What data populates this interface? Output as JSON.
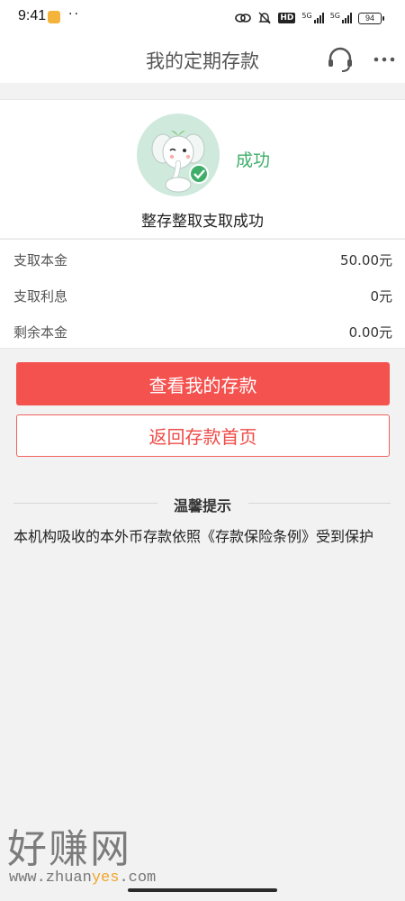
{
  "status_bar": {
    "time": "9:41",
    "hd": "HD",
    "signal1": "5G",
    "signal2": "5G",
    "battery": "94"
  },
  "nav": {
    "title": "我的定期存款",
    "service_icon": "headset-icon",
    "more_icon": "more-dots-icon"
  },
  "result": {
    "badge": "成功",
    "message": "整存整取支取成功",
    "mascot": "elephant-mascot-check"
  },
  "details": [
    {
      "label": "支取本金",
      "value": "50.00元"
    },
    {
      "label": "支取利息",
      "value": "0元"
    },
    {
      "label": "剩余本金",
      "value": "0.00元"
    }
  ],
  "buttons": {
    "view_deposits": "查看我的存款",
    "back_home": "返回存款首页"
  },
  "tips": {
    "title": "温馨提示",
    "body": "本机构吸收的本外币存款依照《存款保险条例》受到保护"
  },
  "watermark": {
    "main": "好赚网",
    "url_pre": "www.zhuan",
    "url_hl": "yes",
    "url_post": ".com"
  },
  "colors": {
    "primary": "#f4524f",
    "success": "#3fae6a",
    "background": "#f2f2f2"
  }
}
